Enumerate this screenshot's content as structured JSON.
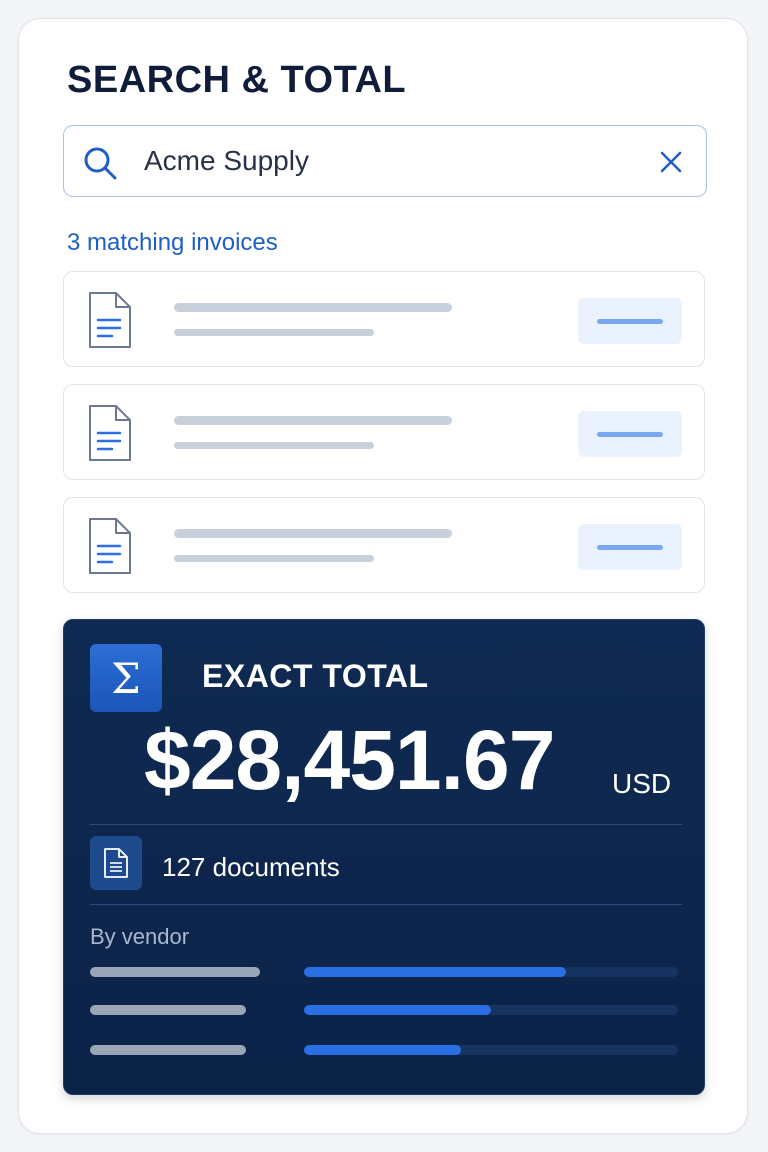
{
  "title": "SEARCH & TOTAL",
  "search": {
    "value": "Acme Supply",
    "placeholder": ""
  },
  "results": {
    "match_label": "3 matching invoices",
    "rows": [
      {},
      {},
      {}
    ]
  },
  "total": {
    "label": "EXACT TOTAL",
    "amount": "$28,451.67",
    "currency": "USD",
    "documents_label": "127 documents",
    "breakdown_label": "By vendor",
    "vendor_share": [
      0.7,
      0.5,
      0.42
    ]
  },
  "icons": {
    "search": "search-icon",
    "clear": "close-icon",
    "document": "document-icon",
    "sigma": "sigma-icon"
  },
  "colors": {
    "accent": "#1d5fc7",
    "panel": "#0f2a52",
    "bar_fill": "#2a6fe3"
  }
}
